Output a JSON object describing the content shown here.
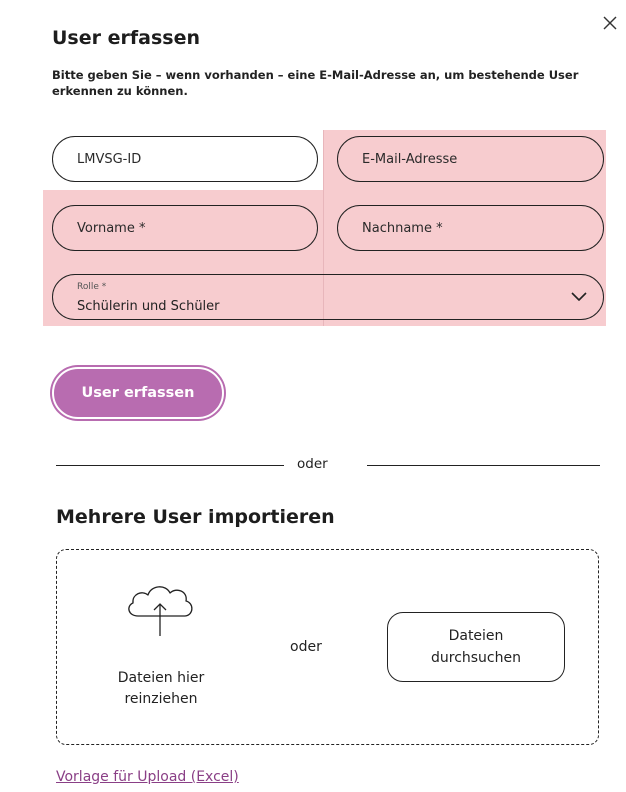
{
  "dialog": {
    "close_icon": "close-icon",
    "title": "User erfassen",
    "description": "Bitte geben Sie – wenn vorhanden – eine E-Mail-Adresse an, um bestehende User erkennen zu können."
  },
  "form": {
    "lmvsg_id_placeholder": "LMVSG-ID",
    "email_placeholder": "E-Mail-Adresse",
    "firstname_placeholder": "Vorname *",
    "lastname_placeholder": "Nachname *",
    "role_label": "Rolle *",
    "role_value": "Schülerin und Schüler",
    "role_icon": "chevron-down-icon",
    "submit_label": "User erfassen"
  },
  "separator": {
    "label": "oder"
  },
  "import": {
    "title": "Mehrere User importieren",
    "upload_icon": "cloud-upload-icon",
    "drop_text": "Dateien hier reinziehen",
    "or_label": "oder",
    "browse_label": "Dateien durchsuchen",
    "template_link": "Vorlage für Upload (Excel)"
  },
  "colors": {
    "accent": "#b86cb0",
    "highlight": "#f7cccf",
    "link": "#8a3f86"
  }
}
